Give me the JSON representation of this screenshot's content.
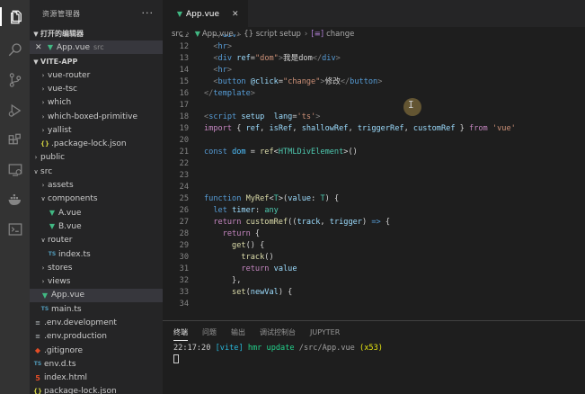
{
  "sidebar": {
    "title": "资源管理器",
    "open_editors_label": "打开的编辑器",
    "open_file": {
      "name": "App.vue",
      "desc": "src"
    },
    "project_label": "VITE-APP",
    "tree": [
      {
        "label": "vue-router",
        "kind": "folder",
        "depth": 1
      },
      {
        "label": "vue-tsc",
        "kind": "folder",
        "depth": 1
      },
      {
        "label": "which",
        "kind": "folder",
        "depth": 1
      },
      {
        "label": "which-boxed-primitive",
        "kind": "folder",
        "depth": 1
      },
      {
        "label": "yallist",
        "kind": "folder",
        "depth": 1
      },
      {
        "label": ".package-lock.json",
        "kind": "json",
        "depth": 1
      },
      {
        "label": "public",
        "kind": "folder",
        "depth": 0
      },
      {
        "label": "src",
        "kind": "folder-open",
        "depth": 0
      },
      {
        "label": "assets",
        "kind": "folder",
        "depth": 1
      },
      {
        "label": "components",
        "kind": "folder-open",
        "depth": 1
      },
      {
        "label": "A.vue",
        "kind": "vue",
        "depth": 2
      },
      {
        "label": "B.vue",
        "kind": "vue",
        "depth": 2
      },
      {
        "label": "router",
        "kind": "folder-open",
        "depth": 1
      },
      {
        "label": "index.ts",
        "kind": "ts",
        "depth": 2
      },
      {
        "label": "stores",
        "kind": "folder",
        "depth": 1
      },
      {
        "label": "views",
        "kind": "folder",
        "depth": 1
      },
      {
        "label": "App.vue",
        "kind": "vue",
        "depth": 1,
        "active": true
      },
      {
        "label": "main.ts",
        "kind": "ts",
        "depth": 1
      },
      {
        "label": ".env.development",
        "kind": "env",
        "depth": 0
      },
      {
        "label": ".env.production",
        "kind": "env",
        "depth": 0
      },
      {
        "label": ".gitignore",
        "kind": "git",
        "depth": 0
      },
      {
        "label": "env.d.ts",
        "kind": "ts",
        "depth": 0
      },
      {
        "label": "index.html",
        "kind": "html",
        "depth": 0
      },
      {
        "label": "package-lock.json",
        "kind": "json",
        "depth": 0
      }
    ]
  },
  "editor": {
    "tab_label": "App.vue",
    "breadcrumb": [
      "src",
      "App.vue",
      "{} script setup",
      "change"
    ],
    "lines": [
      {
        "n": "11",
        "html": "  <span class=\"t-tag\">&lt;/</span><span class=\"t-tn\">div</span><span class=\"t-tag\">&gt;</span>"
      },
      {
        "n": "12",
        "html": "  <span class=\"t-tag\">&lt;</span><span class=\"t-tn\">hr</span><span class=\"t-tag\">&gt;</span>"
      },
      {
        "n": "13",
        "html": "  <span class=\"t-tag\">&lt;</span><span class=\"t-tn\">div</span> <span class=\"t-at\">ref</span>=<span class=\"t-str\">\"dom\"</span><span class=\"t-tag\">&gt;</span>我是dom<span class=\"t-tag\">&lt;/</span><span class=\"t-tn\">div</span><span class=\"t-tag\">&gt;</span>"
      },
      {
        "n": "14",
        "html": "  <span class=\"t-tag\">&lt;</span><span class=\"t-tn\">hr</span><span class=\"t-tag\">&gt;</span>"
      },
      {
        "n": "15",
        "html": "  <span class=\"t-tag\">&lt;</span><span class=\"t-tn\">button</span> <span class=\"t-at\">@click</span>=<span class=\"t-str\">\"change\"</span><span class=\"t-tag\">&gt;</span>修改<span class=\"t-tag\">&lt;/</span><span class=\"t-tn\">button</span><span class=\"t-tag\">&gt;</span>"
      },
      {
        "n": "16",
        "html": "<span class=\"t-tag\">&lt;/</span><span class=\"t-tn\">template</span><span class=\"t-tag\">&gt;</span>"
      },
      {
        "n": "17",
        "html": ""
      },
      {
        "n": "18",
        "html": "<span class=\"t-tag\">&lt;</span><span class=\"t-tn\">script</span> <span class=\"t-at\">setup</span>  <span class=\"t-at\">lang</span>=<span class=\"t-str\">'ts'</span><span class=\"t-tag\">&gt;</span>"
      },
      {
        "n": "19",
        "html": "<span class=\"t-kw\">import</span> { <span class=\"t-var\">ref</span>, <span class=\"t-var\">isRef</span>, <span class=\"t-var\">shallowRef</span>, <span class=\"t-var\">triggerRef</span>, <span class=\"t-var\">customRef</span> } <span class=\"t-kw\">from</span> <span class=\"t-str\">'vue'</span>"
      },
      {
        "n": "20",
        "html": ""
      },
      {
        "n": "21",
        "html": "<span class=\"t-st\">const</span> <span class=\"t-cst\">dom</span> = <span class=\"t-fn\">ref</span>&lt;<span class=\"t-ty\">HTMLDivElement</span>&gt;()"
      },
      {
        "n": "22",
        "html": ""
      },
      {
        "n": "23",
        "html": ""
      },
      {
        "n": "24",
        "html": ""
      },
      {
        "n": "25",
        "html": "<span class=\"t-st\">function</span> <span class=\"t-fn\">MyRef</span>&lt;<span class=\"t-ty\">T</span>&gt;(<span class=\"t-var\">value</span>: <span class=\"t-ty\">T</span>) {"
      },
      {
        "n": "26",
        "html": "  <span class=\"t-st\">let</span> <span class=\"t-var\">timer</span>: <span class=\"t-ty\">any</span>"
      },
      {
        "n": "27",
        "html": "  <span class=\"t-kw\">return</span> <span class=\"t-fn\">customRef</span>((<span class=\"t-var\">track</span>, <span class=\"t-var\">trigger</span>) <span class=\"t-st\">=&gt;</span> {"
      },
      {
        "n": "28",
        "html": "    <span class=\"t-kw\">return</span> {"
      },
      {
        "n": "29",
        "html": "      <span class=\"t-fn\">get</span>() {"
      },
      {
        "n": "30",
        "html": "        <span class=\"t-fn\">track</span>()"
      },
      {
        "n": "31",
        "html": "        <span class=\"t-kw\">return</span> <span class=\"t-var\">value</span>"
      },
      {
        "n": "32",
        "html": "      },"
      },
      {
        "n": "33",
        "html": "      <span class=\"t-fn\">set</span>(<span class=\"t-var\">newVal</span>) {"
      },
      {
        "n": "34",
        "html": ""
      }
    ]
  },
  "panel": {
    "tabs": [
      "终端",
      "问题",
      "输出",
      "调试控制台",
      "JUPYTER"
    ],
    "active_tab": "终端",
    "terminal": {
      "time": "22:17:20",
      "tag": "[vite]",
      "msg": "hmr update",
      "path": "/src/App.vue",
      "count": "(x53)"
    }
  }
}
